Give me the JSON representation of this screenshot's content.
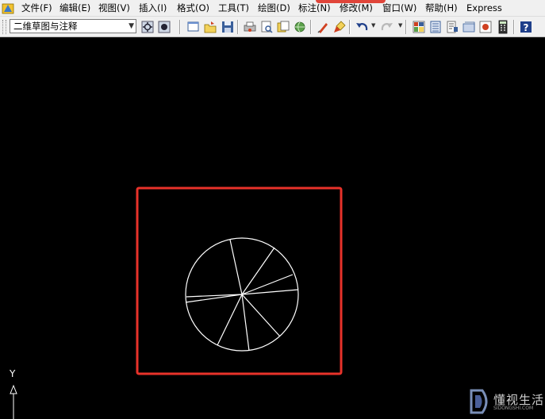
{
  "menubar": {
    "items": [
      {
        "label": "文件(F)"
      },
      {
        "label": "编辑(E)"
      },
      {
        "label": "视图(V)"
      },
      {
        "label": "插入(I)"
      },
      {
        "label": "格式(O)"
      },
      {
        "label": "工具(T)"
      },
      {
        "label": "绘图(D)"
      },
      {
        "label": "标注(N)"
      },
      {
        "label": "修改(M)"
      },
      {
        "label": "窗口(W)"
      },
      {
        "label": "帮助(H)"
      },
      {
        "label": "Express"
      }
    ]
  },
  "toolbar": {
    "workspace": {
      "value": "二维草图与注释"
    },
    "icons": [
      "workspace-settings-icon",
      "workspace-save-icon",
      "new-file-icon",
      "open-file-icon",
      "save-icon",
      "plot-icon",
      "plot-preview-icon",
      "publish-icon",
      "3d-dwf-icon",
      "match-properties-icon",
      "paintbrush-icon",
      "undo-icon",
      "redo-icon",
      "properties-icon",
      "design-center-icon",
      "tool-palettes-icon",
      "sheet-set-icon",
      "markup-icon",
      "calculator-icon",
      "help-icon"
    ]
  },
  "canvas": {
    "ucs_label": "Y",
    "highlight_color": "#e8322a",
    "stroke_color": "#ffffff"
  },
  "watermark": {
    "main": "懂视生活",
    "sub": "SIDONGSHI.COM"
  }
}
